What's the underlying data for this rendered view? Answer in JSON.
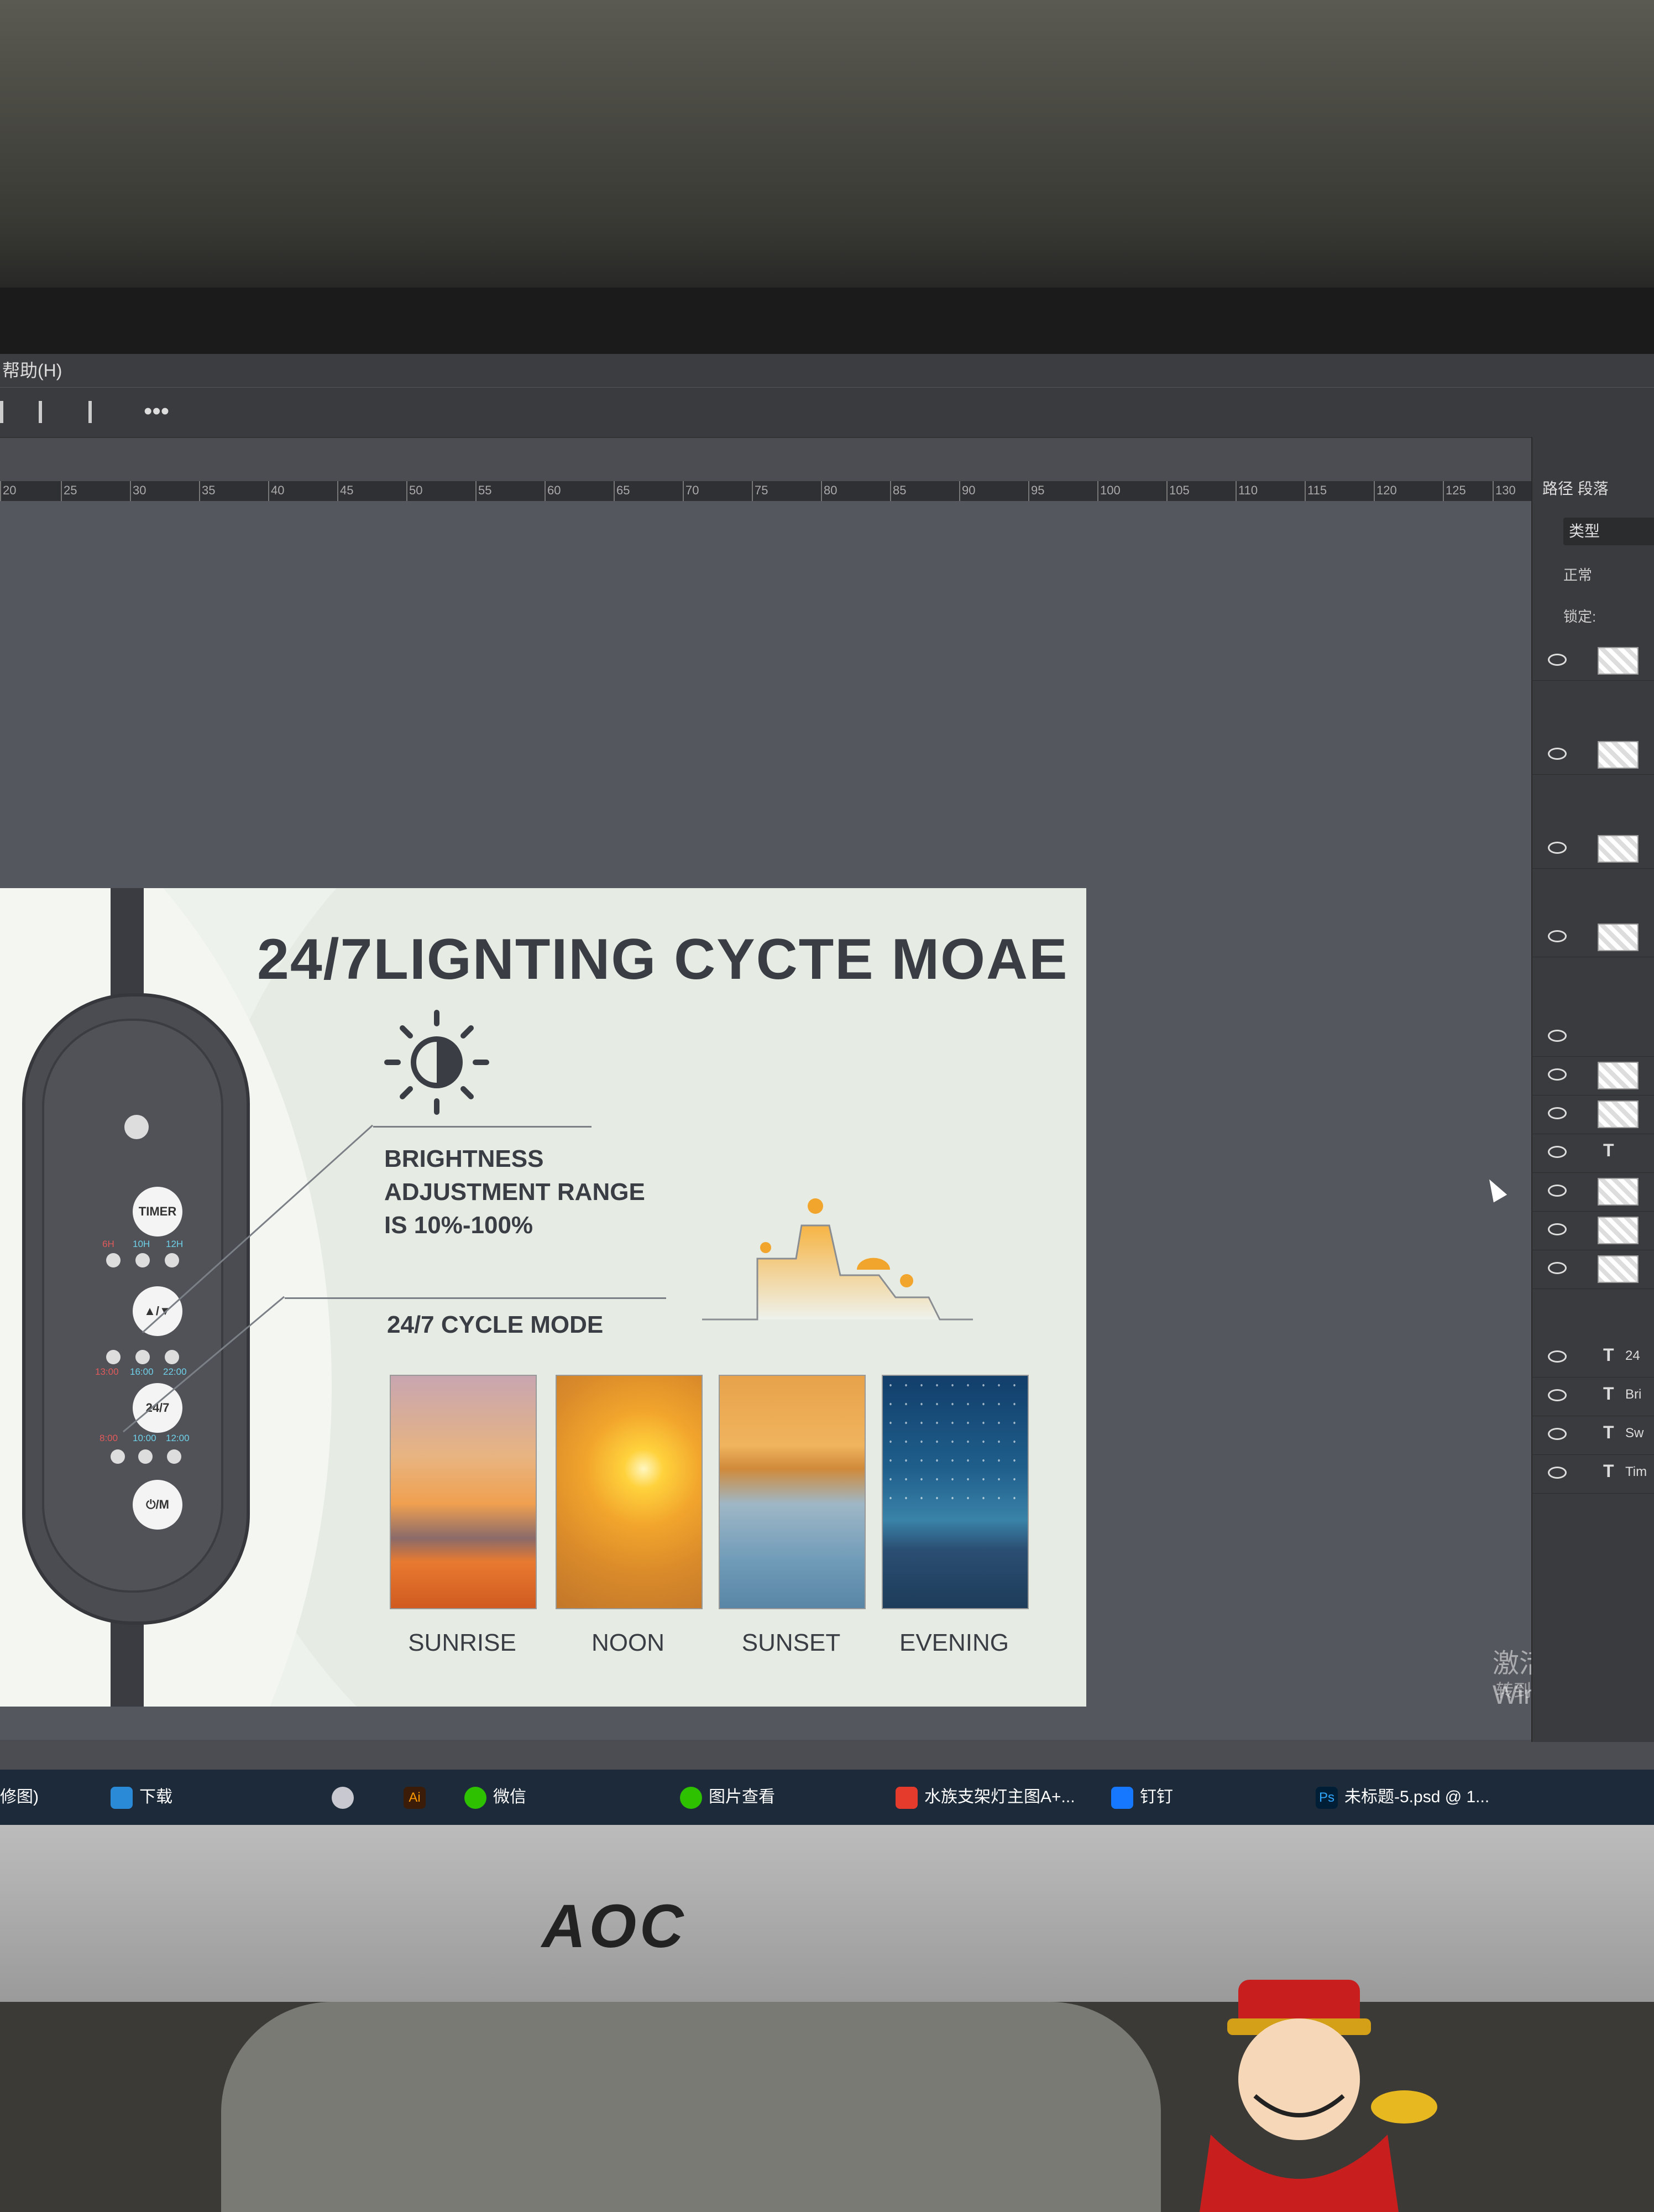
{
  "menu": {
    "help": "帮助(H)"
  },
  "toolbar": {
    "more": "•••"
  },
  "ruler": {
    "ticks": [
      "20",
      "25",
      "30",
      "35",
      "40",
      "45",
      "50",
      "55",
      "60",
      "65",
      "70",
      "75",
      "80",
      "85",
      "90",
      "95",
      "100",
      "105",
      "110",
      "115",
      "120",
      "125",
      "130"
    ]
  },
  "artboard": {
    "title": "24/7LIGNTING CYCTE MOAE",
    "brightness_lines": [
      "BRIGHTNESS",
      "ADJUSTMENT RANGE",
      "IS 10%-100%"
    ],
    "cycle_mode": "24/7 CYCLE MODE",
    "scenes": [
      {
        "label": "SUNRISE"
      },
      {
        "label": "NOON"
      },
      {
        "label": "SUNSET"
      },
      {
        "label": "EVENING"
      }
    ],
    "remote": {
      "timer": "TIMER",
      "timer_opts": [
        "6H",
        "10H",
        "12H"
      ],
      "cycle_opts": [
        "13:00",
        "16:00",
        "22:00"
      ],
      "cycle2_opts": [
        "8:00",
        "10:00",
        "12:00"
      ],
      "btn_brightness": "▲/▼",
      "btn_247": "24/7",
      "btn_mode": "⏻/M"
    }
  },
  "panel": {
    "tabs": "路径  段落",
    "search": "类型",
    "blend": "正常",
    "lock": "锁定:",
    "text_layers": [
      "24",
      "Bri",
      "Sw",
      "Tim"
    ]
  },
  "watermark": {
    "line1": "激活 Windows",
    "line2": "转到\"设置\"以激活"
  },
  "taskbar": {
    "items": [
      "修图)",
      "下载",
      "微信",
      "图片查看",
      "水族支架灯主图A+...",
      "钉钉",
      "未标题-5.psd @ 1..."
    ],
    "ai": "Ai",
    "ps": "Ps"
  },
  "monitor": {
    "brand": "AOC"
  },
  "colors": {
    "title": "#3a3d44",
    "background": "#eef2ec",
    "accent_orange": "#f2a52c"
  }
}
